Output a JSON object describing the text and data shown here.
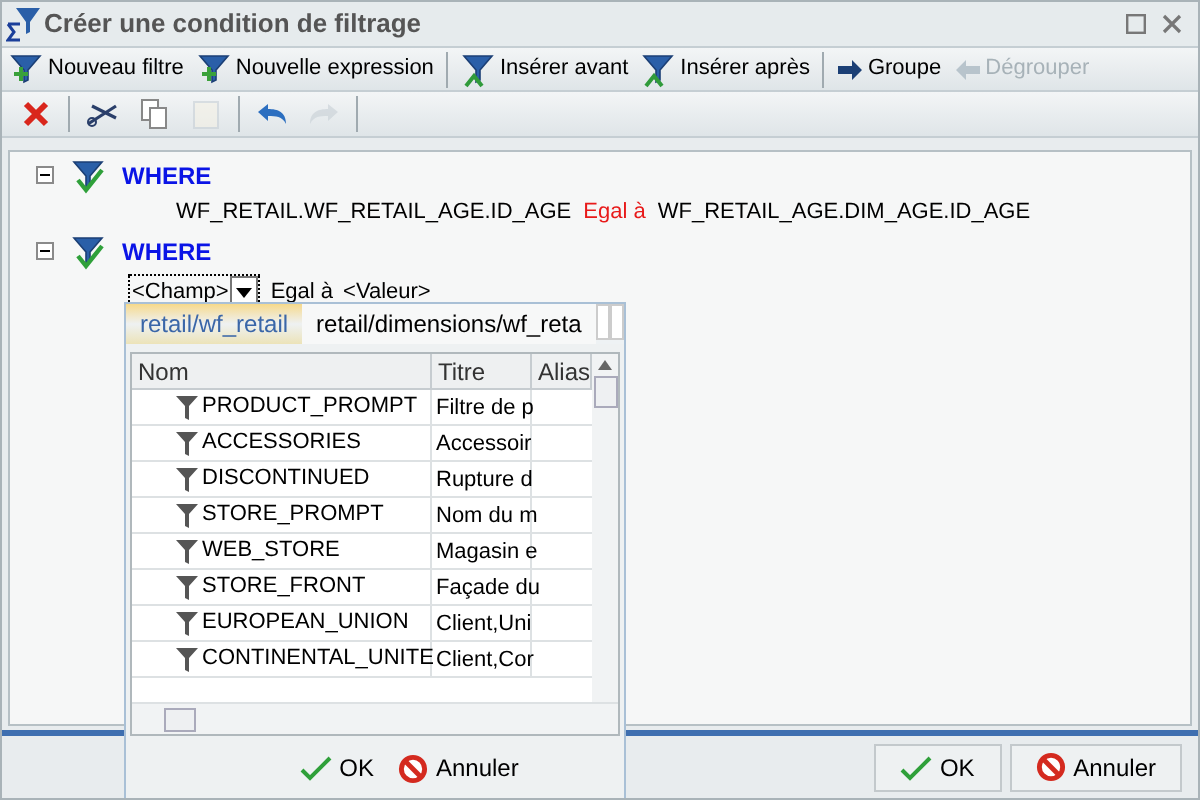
{
  "window": {
    "title": "Créer une condition de filtrage"
  },
  "toolbar": [
    {
      "label": "Nouveau filtre",
      "disabled": false
    },
    {
      "label": "Nouvelle expression",
      "disabled": false
    },
    {
      "label": "Insérer avant",
      "disabled": false
    },
    {
      "label": "Insérer après",
      "disabled": false
    },
    {
      "label": "Groupe",
      "disabled": false
    },
    {
      "label": "Dégrouper",
      "disabled": true
    }
  ],
  "edit_toolbar": [
    {
      "kind": "delete",
      "disabled": false
    },
    {
      "kind": "cut",
      "disabled": false
    },
    {
      "kind": "copy",
      "disabled": false
    },
    {
      "kind": "paste",
      "disabled": true
    },
    {
      "kind": "undo",
      "disabled": false
    },
    {
      "kind": "redo",
      "disabled": true
    }
  ],
  "tree": [
    {
      "label": "WHERE",
      "expanded": true,
      "children": [
        {
          "kind": "expression",
          "left": "WF_RETAIL.WF_RETAIL_AGE.ID_AGE",
          "operator": "Egal à",
          "right": "WF_RETAIL_AGE.DIM_AGE.ID_AGE"
        }
      ]
    },
    {
      "label": "WHERE",
      "expanded": true,
      "children": [
        {
          "kind": "editor",
          "field": "<Champ>",
          "operator": "Egal à",
          "value": "<Valeur>"
        }
      ]
    }
  ],
  "popup": {
    "tabs": [
      {
        "label": "retail/wf_retail",
        "selected": true
      },
      {
        "label": "retail/dimensions/wf_reta",
        "selected": false
      }
    ],
    "columns": [
      "Nom",
      "Titre",
      "Alias"
    ],
    "rows": [
      {
        "name": "PRODUCT_PROMPT",
        "title": "Filtre de p"
      },
      {
        "name": "ACCESSORIES",
        "title": "Accessoir"
      },
      {
        "name": "DISCONTINUED",
        "title": "Rupture d"
      },
      {
        "name": "STORE_PROMPT",
        "title": "Nom du m"
      },
      {
        "name": "WEB_STORE",
        "title": "Magasin e"
      },
      {
        "name": "STORE_FRONT",
        "title": "Façade du"
      },
      {
        "name": "EUROPEAN_UNION",
        "title": "Client,Uni"
      },
      {
        "name": "CONTINENTAL_UNITE",
        "title": "Client,Cor"
      }
    ],
    "buttons": [
      {
        "kind": "ok",
        "label": "OK"
      },
      {
        "kind": "cancel",
        "label": "Annuler"
      }
    ]
  },
  "buttons": [
    {
      "kind": "ok",
      "label": "OK"
    },
    {
      "kind": "cancel",
      "label": "Annuler"
    }
  ]
}
